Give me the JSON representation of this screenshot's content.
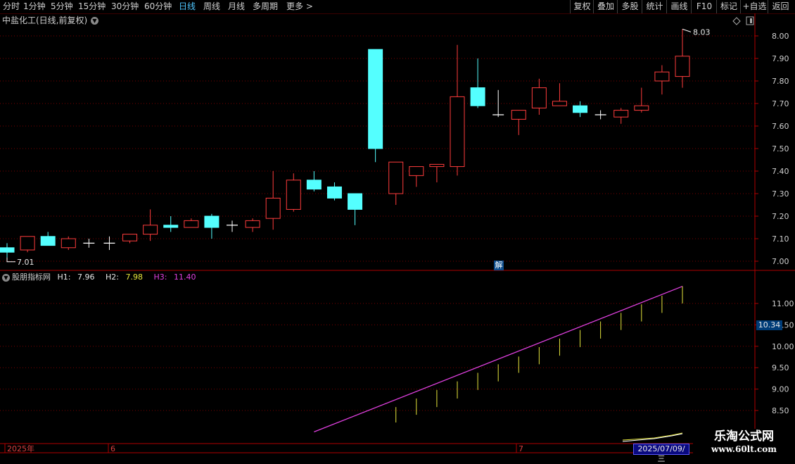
{
  "toolbar": {
    "left_items": [
      "分时",
      "1分钟",
      "5分钟",
      "15分钟",
      "30分钟",
      "60分钟",
      "日线",
      "周线",
      "月线",
      "多周期",
      "更多"
    ],
    "active": "日线",
    "right_items": [
      "复权",
      "叠加",
      "多股",
      "统计",
      "画线",
      "F10",
      "标记",
      "+自选",
      "返回"
    ]
  },
  "main_chart": {
    "title": "中盐化工(日线,前复权)",
    "price_axis": [
      "8.00",
      "7.90",
      "7.80",
      "7.70",
      "7.60",
      "7.50",
      "7.40",
      "7.30",
      "7.20",
      "7.10",
      "7.00"
    ],
    "high_label": "8.03",
    "low_label": "7.01",
    "jie_badge": "解"
  },
  "indicator": {
    "name": "股朋指标网",
    "h1_label": "H1:",
    "h1_value": "7.96",
    "h2_label": "H2:",
    "h2_value": "7.98",
    "h3_label": "H3:",
    "h3_value": "11.40",
    "axis": [
      "11.00",
      "10.50",
      "10.00",
      "9.50",
      "9.00",
      "8.50"
    ],
    "current_value": "10.34"
  },
  "time_axis": {
    "labels": [
      "2025年",
      "6",
      "7"
    ],
    "cursor_date": "2025/07/09/三"
  },
  "watermark": {
    "line1": "乐淘公式网",
    "line2": "www.60lt.com"
  },
  "colors": {
    "up": "#ff3c3c",
    "down": "#54ffff",
    "flat": "#ffffff",
    "grid": "#7a0000",
    "axis": "#b00000"
  },
  "chart_data": {
    "type": "candlestick",
    "price_range": [
      6.95,
      8.05
    ],
    "candles": [
      {
        "o": 7.06,
        "h": 7.08,
        "l": 7.01,
        "c": 7.04,
        "dir": "down"
      },
      {
        "o": 7.05,
        "h": 7.11,
        "l": 7.04,
        "c": 7.11,
        "dir": "up"
      },
      {
        "o": 7.11,
        "h": 7.13,
        "l": 7.07,
        "c": 7.07,
        "dir": "down"
      },
      {
        "o": 7.06,
        "h": 7.11,
        "l": 7.05,
        "c": 7.1,
        "dir": "up"
      },
      {
        "o": 7.08,
        "h": 7.1,
        "l": 7.06,
        "c": 7.08,
        "dir": "flat"
      },
      {
        "o": 7.08,
        "h": 7.11,
        "l": 7.05,
        "c": 7.08,
        "dir": "flat"
      },
      {
        "o": 7.09,
        "h": 7.12,
        "l": 7.08,
        "c": 7.12,
        "dir": "up"
      },
      {
        "o": 7.12,
        "h": 7.23,
        "l": 7.09,
        "c": 7.16,
        "dir": "up"
      },
      {
        "o": 7.16,
        "h": 7.2,
        "l": 7.13,
        "c": 7.15,
        "dir": "down"
      },
      {
        "o": 7.15,
        "h": 7.19,
        "l": 7.15,
        "c": 7.18,
        "dir": "up"
      },
      {
        "o": 7.2,
        "h": 7.21,
        "l": 7.1,
        "c": 7.15,
        "dir": "down"
      },
      {
        "o": 7.16,
        "h": 7.18,
        "l": 7.13,
        "c": 7.16,
        "dir": "flat"
      },
      {
        "o": 7.15,
        "h": 7.19,
        "l": 7.13,
        "c": 7.18,
        "dir": "up"
      },
      {
        "o": 7.19,
        "h": 7.4,
        "l": 7.14,
        "c": 7.28,
        "dir": "up"
      },
      {
        "o": 7.23,
        "h": 7.39,
        "l": 7.22,
        "c": 7.36,
        "dir": "up"
      },
      {
        "o": 7.36,
        "h": 7.4,
        "l": 7.31,
        "c": 7.32,
        "dir": "down"
      },
      {
        "o": 7.33,
        "h": 7.35,
        "l": 7.27,
        "c": 7.28,
        "dir": "down"
      },
      {
        "o": 7.3,
        "h": 7.3,
        "l": 7.16,
        "c": 7.23,
        "dir": "down"
      },
      {
        "o": 7.94,
        "h": 7.94,
        "l": 7.44,
        "c": 7.5,
        "dir": "down"
      },
      {
        "o": 7.3,
        "h": 7.44,
        "l": 7.25,
        "c": 7.44,
        "dir": "up"
      },
      {
        "o": 7.38,
        "h": 7.42,
        "l": 7.33,
        "c": 7.42,
        "dir": "up"
      },
      {
        "o": 7.42,
        "h": 7.43,
        "l": 7.35,
        "c": 7.43,
        "dir": "up"
      },
      {
        "o": 7.42,
        "h": 7.96,
        "l": 7.38,
        "c": 7.73,
        "dir": "up"
      },
      {
        "o": 7.77,
        "h": 7.9,
        "l": 7.68,
        "c": 7.69,
        "dir": "down"
      },
      {
        "o": 7.65,
        "h": 7.76,
        "l": 7.64,
        "c": 7.65,
        "dir": "flat"
      },
      {
        "o": 7.63,
        "h": 7.67,
        "l": 7.56,
        "c": 7.67,
        "dir": "up"
      },
      {
        "o": 7.68,
        "h": 7.81,
        "l": 7.65,
        "c": 7.77,
        "dir": "up"
      },
      {
        "o": 7.69,
        "h": 7.79,
        "l": 7.69,
        "c": 7.71,
        "dir": "up"
      },
      {
        "o": 7.69,
        "h": 7.71,
        "l": 7.64,
        "c": 7.66,
        "dir": "down"
      },
      {
        "o": 7.65,
        "h": 7.67,
        "l": 7.63,
        "c": 7.65,
        "dir": "flat"
      },
      {
        "o": 7.64,
        "h": 7.68,
        "l": 7.61,
        "c": 7.67,
        "dir": "up"
      },
      {
        "o": 7.67,
        "h": 7.77,
        "l": 7.66,
        "c": 7.69,
        "dir": "up"
      },
      {
        "o": 7.8,
        "h": 7.87,
        "l": 7.74,
        "c": 7.84,
        "dir": "up"
      },
      {
        "o": 7.82,
        "h": 8.03,
        "l": 7.77,
        "c": 7.91,
        "dir": "up"
      }
    ],
    "indicator_range": [
      8.25,
      11.75
    ],
    "indicator_line": {
      "start_index": 15,
      "start_value": 8.0,
      "end_index": 33,
      "end_value": 11.4
    },
    "indicator_bars": [
      {
        "index": 19,
        "top": 8.58,
        "bottom": 8.22
      },
      {
        "index": 20,
        "top": 8.78,
        "bottom": 8.4
      },
      {
        "index": 21,
        "top": 8.98,
        "bottom": 8.58
      },
      {
        "index": 22,
        "top": 9.18,
        "bottom": 8.78
      },
      {
        "index": 23,
        "top": 9.38,
        "bottom": 8.98
      },
      {
        "index": 24,
        "top": 9.58,
        "bottom": 9.18
      },
      {
        "index": 25,
        "top": 9.76,
        "bottom": 9.38
      },
      {
        "index": 26,
        "top": 9.98,
        "bottom": 9.58
      },
      {
        "index": 27,
        "top": 10.18,
        "bottom": 9.78
      },
      {
        "index": 28,
        "top": 10.38,
        "bottom": 9.98
      },
      {
        "index": 29,
        "top": 10.58,
        "bottom": 10.18
      },
      {
        "index": 30,
        "top": 10.78,
        "bottom": 10.38
      },
      {
        "index": 31,
        "top": 10.98,
        "bottom": 10.58
      },
      {
        "index": 32,
        "top": 11.18,
        "bottom": 10.78
      },
      {
        "index": 33,
        "top": 11.4,
        "bottom": 11.0
      }
    ]
  }
}
